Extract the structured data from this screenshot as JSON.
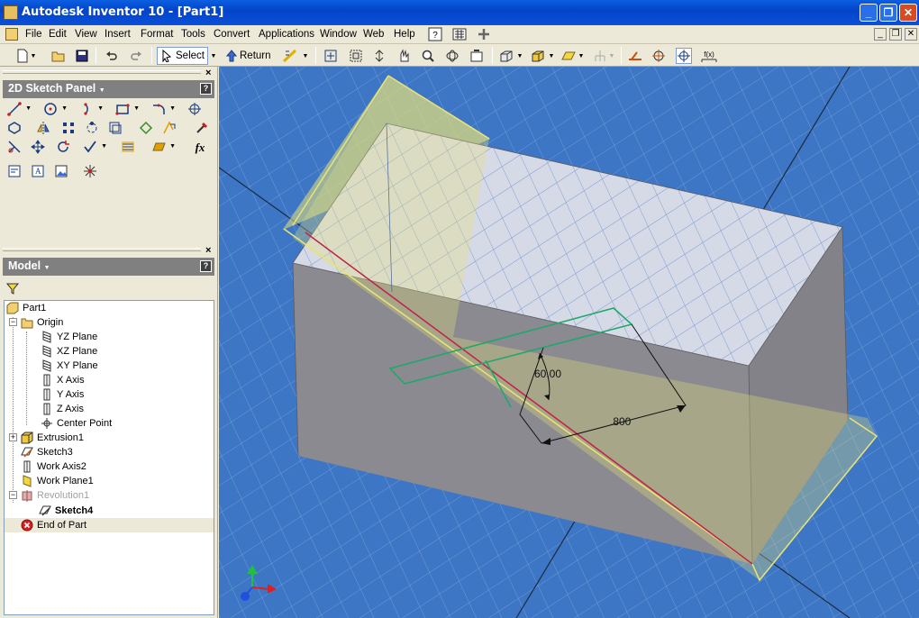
{
  "window": {
    "title": "Autodesk Inventor 10 - [Part1]"
  },
  "menu": [
    "File",
    "Edit",
    "View",
    "Insert",
    "Format",
    "Tools",
    "Convert",
    "Applications",
    "Window",
    "Web",
    "Help"
  ],
  "toolbar": {
    "select_label": "Select",
    "return_label": "Return"
  },
  "sketch_panel": {
    "title": "2D Sketch Panel"
  },
  "model_panel": {
    "title": "Model"
  },
  "tree": {
    "part": "Part1",
    "origin": "Origin",
    "yz_plane": "YZ Plane",
    "xz_plane": "XZ Plane",
    "xy_plane": "XY Plane",
    "x_axis": "X Axis",
    "y_axis": "Y Axis",
    "z_axis": "Z Axis",
    "center_point": "Center Point",
    "extrusion1": "Extrusion1",
    "sketch3": "Sketch3",
    "work_axis2": "Work Axis2",
    "work_plane1": "Work Plane1",
    "revolution1": "Revolution1",
    "sketch4": "Sketch4",
    "end_of_part": "End of Part"
  },
  "viewport": {
    "angle_dim": "60.00",
    "length_dim": ".800"
  },
  "colors": {
    "title_bar": "#0a50d8",
    "viewport_bg": "#3d76c4",
    "work_plane": "#e6e27a",
    "sketch_line": "#1ea86a"
  }
}
